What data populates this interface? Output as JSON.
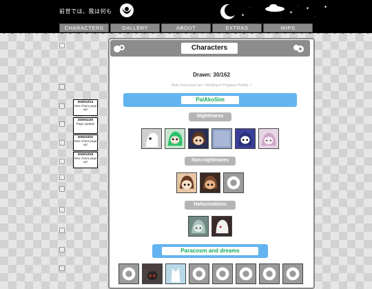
{
  "site": {
    "title": "前世では、我は何も"
  },
  "nav": {
    "items": [
      "CHARACTERS",
      "GALLERY",
      "ABOUT",
      "EXTRAS",
      "WIPS"
    ]
  },
  "news": [
    {
      "date": "2025/12/14",
      "text": "New chara page up!"
    },
    {
      "date": "2025/11/20",
      "text": "Page update!"
    },
    {
      "date": "2025/10/31",
      "text": "New chara page up!"
    },
    {
      "date": "2025/10/26",
      "text": "New chara page up!"
    }
  ],
  "panel": {
    "title": "Characters",
    "drawn": "Drawn: 30/162",
    "subtitle": "Mute toned pixel art = Working in Progress Priority. :/"
  },
  "sections": {
    "palakosim": "PalAkoSim",
    "nightmares": "Nightmares",
    "non_nightmares": "Non-nightmares",
    "hallucinations": "Hallucinations",
    "paracosm": "Paracosm and dreams"
  },
  "colors": {
    "accent": "#63b4f0",
    "pill": "#b5b5b5",
    "header": "#000000"
  },
  "icons": [
    "moon-icon",
    "cloud-icon",
    "eye-emblem-icon",
    "speech-bubble-icon",
    "broken-image-icon"
  ]
}
